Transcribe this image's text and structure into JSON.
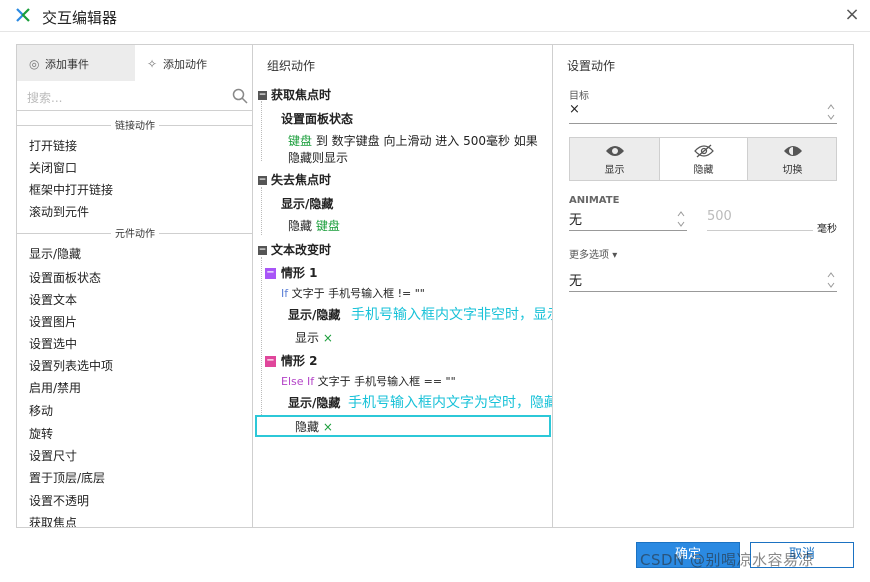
{
  "window": {
    "title": "交互编辑器",
    "close_glyph": "×"
  },
  "left": {
    "tabs": [
      {
        "label": "添加事件",
        "icon": "event-icon"
      },
      {
        "label": "添加动作",
        "icon": "action-icon"
      }
    ],
    "search_placeholder": "搜索...",
    "sections": [
      {
        "title": "链接动作",
        "items": [
          "打开链接",
          "关闭窗口",
          "框架中打开链接",
          "滚动到元件"
        ]
      },
      {
        "title": "元件动作",
        "items": [
          "显示/隐藏",
          "设置面板状态",
          "设置文本",
          "设置图片",
          "设置选中",
          "设置列表选中项",
          "启用/禁用",
          "移动",
          "旋转",
          "设置尺寸",
          "置于顶层/底层",
          "设置不透明",
          "获取焦点"
        ]
      }
    ]
  },
  "middle": {
    "header": "组织动作",
    "ev1": {
      "title": "获取焦点时",
      "action": "设置面板状态",
      "line1_kw": "键盘",
      "line1_rest": " 到 数字键盘 向上滑动 进入 500毫秒 如果",
      "line2": "隐藏则显示"
    },
    "ev2": {
      "title": "失去焦点时",
      "action": "显示/隐藏",
      "detail_a": "隐藏 ",
      "detail_kw": "键盘"
    },
    "ev3": {
      "title": "文本改变时",
      "case1": {
        "title": "情形 1",
        "cond_kw": "If",
        "cond": " 文字于 手机号输入框 != \"\"",
        "action": "显示/隐藏",
        "annotation": "手机号输入框内文字非空时，显示×",
        "detail": "显示",
        "x": "×"
      },
      "case2": {
        "title": "情形 2",
        "cond_kw": "Else If",
        "cond": " 文字于 手机号输入框 == \"\"",
        "action": "显示/隐藏",
        "annotation": "手机号输入框内文字为空时，隐藏×",
        "detail": "隐藏",
        "x": "×"
      }
    },
    "collapse_glyph": "−"
  },
  "right": {
    "header": "设置动作",
    "target_label": "目标",
    "target_value": "×",
    "visibility": [
      {
        "label": "显示",
        "icon": "eye-icon"
      },
      {
        "label": "隐藏",
        "icon": "eye-slash-icon",
        "active": true
      },
      {
        "label": "切换",
        "icon": "eye-toggle-icon"
      }
    ],
    "animate_label": "ANIMATE",
    "animate_value": "无",
    "duration_value": "500",
    "duration_unit": "毫秒",
    "more_label": "更多选项",
    "more_caret": "▾",
    "more_value": "无"
  },
  "footer": {
    "ok": "确定",
    "cancel": "取消"
  },
  "watermark": "CSDN @别喝凉水容易凉",
  "colors": {
    "accent": "#2b8ae2",
    "annotation": "#19c2d8",
    "keyword_green": "#1a9e3b",
    "case1": "#a855f7",
    "case2": "#e0469b"
  }
}
